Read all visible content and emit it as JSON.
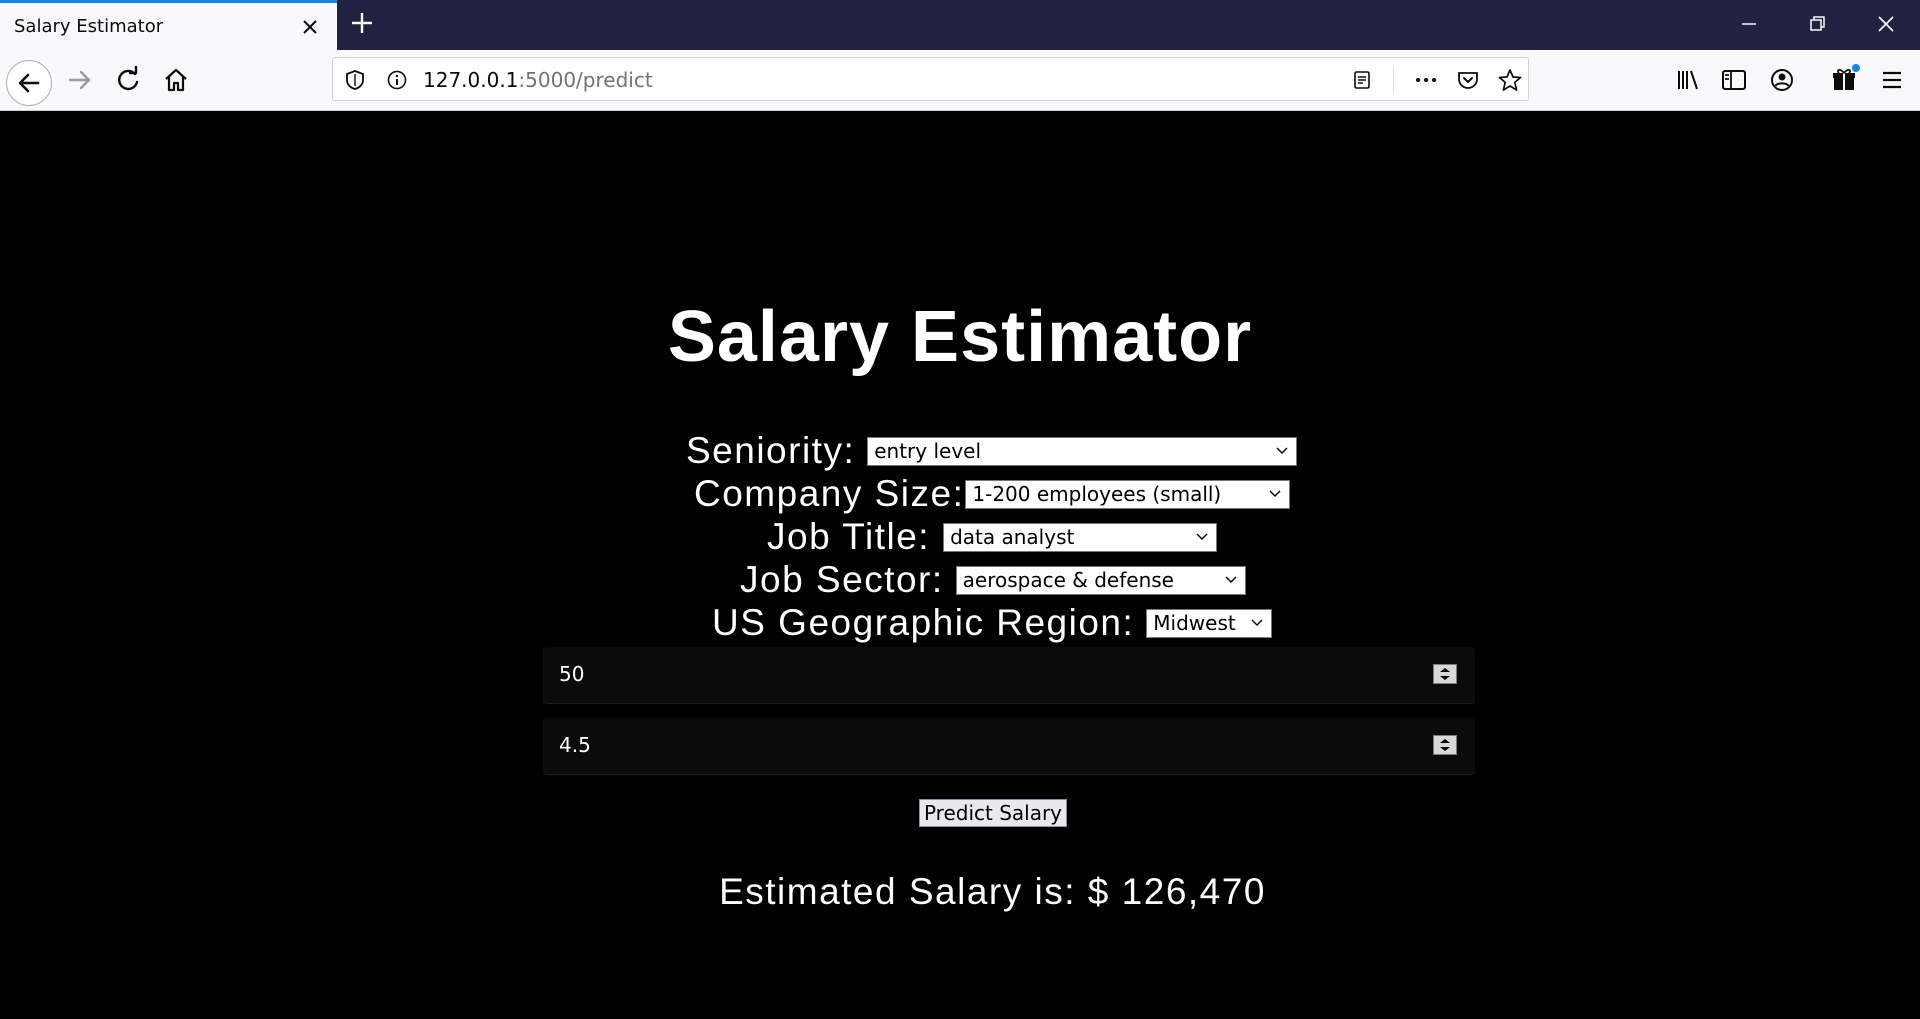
{
  "browser": {
    "tab_title": "Salary Estimator",
    "url_host": "127.0.0.1",
    "url_rest": ":5000/predict"
  },
  "page": {
    "title": "Salary Estimator",
    "fields": {
      "seniority_label": "Seniority:",
      "seniority_value": "entry level",
      "company_size_label": "Company Size:",
      "company_size_value": "1-200 employees (small)",
      "job_title_label": "Job Title:",
      "job_title_value": "data analyst",
      "job_sector_label": "Job Sector:",
      "job_sector_value": "aerospace & defense",
      "region_label": "US Geographic Region:",
      "region_value": "Midwest",
      "number_1_value": "50",
      "number_2_value": "4.5"
    },
    "predict_button": "Predict Salary",
    "result": "Estimated Salary is: $ 126,470"
  },
  "colors": {
    "tab_accent": "#0a84ff",
    "tabbar_bg": "#1f2240",
    "page_bg": "#000000",
    "text": "#ffffff"
  }
}
